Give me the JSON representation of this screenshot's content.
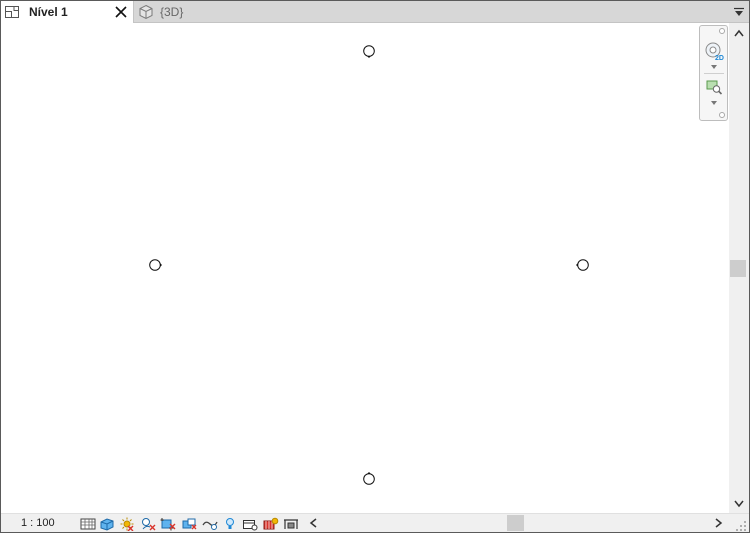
{
  "tabs": [
    {
      "label": "Nível 1",
      "icon": "floor-plan-icon",
      "active": true
    },
    {
      "label": "{3D}",
      "icon": "3d-view-icon",
      "active": false
    }
  ],
  "status": {
    "scale": "1 : 100"
  },
  "colors": {
    "tabbar": "#d7d7d7",
    "statusbar": "#f0f0f0",
    "accent_blue": "#1e88d6",
    "accent_red": "#d9332b",
    "accent_yellow": "#f2b705"
  }
}
